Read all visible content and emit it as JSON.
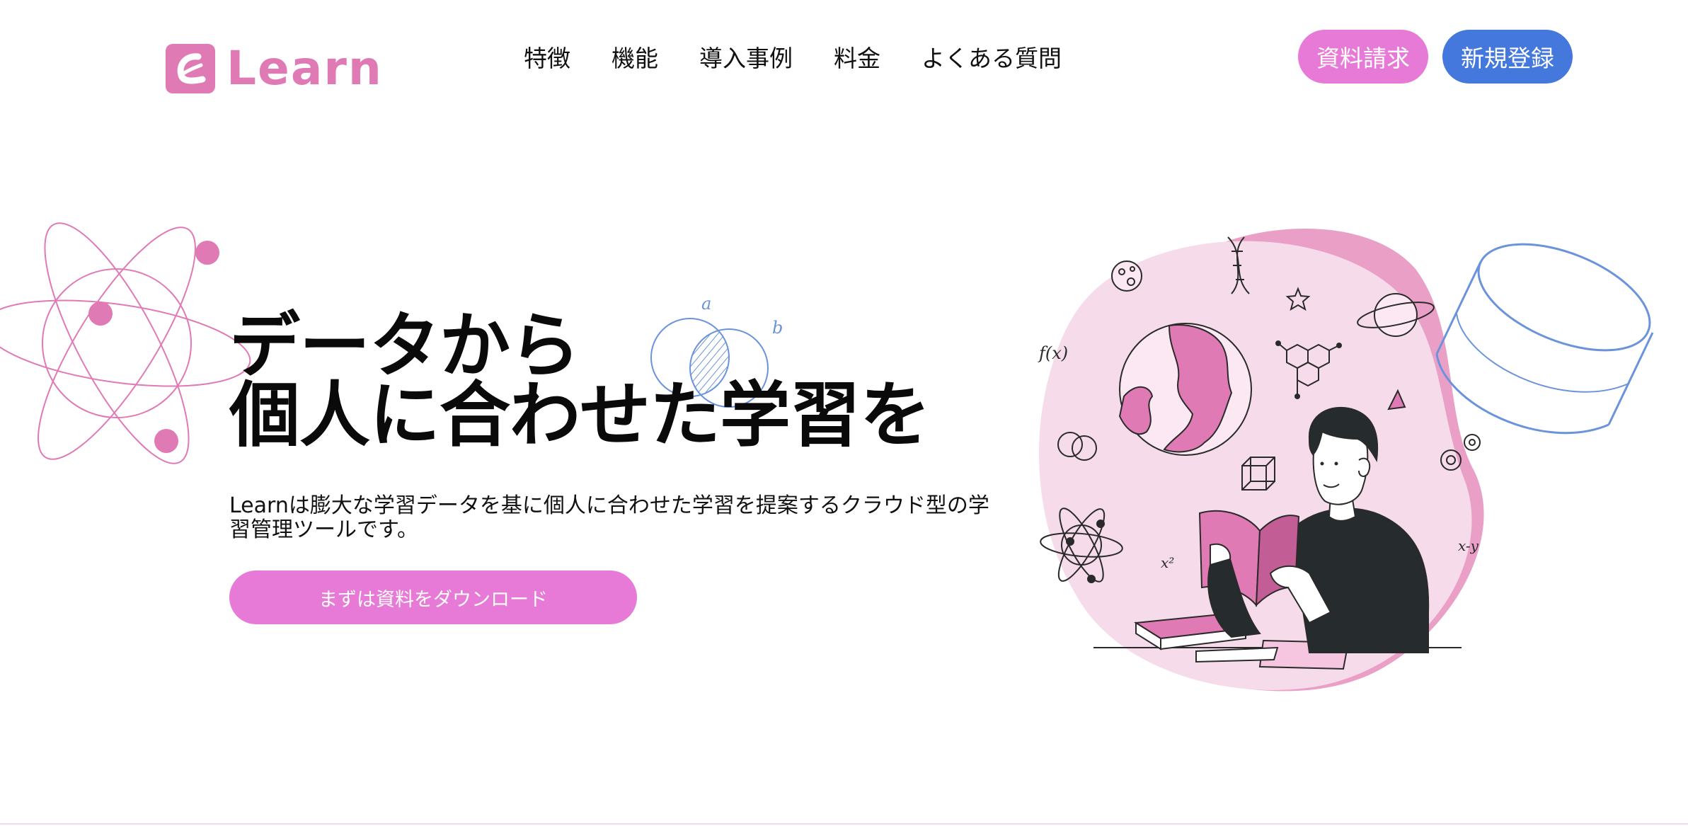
{
  "brand": {
    "name": "Learn",
    "color": "#e07ab5"
  },
  "nav": {
    "items": [
      "特徴",
      "機能",
      "導入事例",
      "料金",
      "よくある質問"
    ]
  },
  "header_buttons": {
    "document_request": "資料請求",
    "register": "新規登録",
    "document_color": "#e67ad6",
    "register_color": "#4478dc"
  },
  "hero": {
    "title_line1": "データから",
    "title_line2": "個人に合わせた学習を",
    "description": "Learnは膨大な学習データを基に個人に合わせた学習を提案するクラウド型の学習管理ツールです。",
    "cta_label": "まずは資料をダウンロード"
  },
  "illustration": {
    "venn_label_a": "a",
    "venn_label_b": "b",
    "function_label": "f(x)",
    "squared_label": "x²",
    "equation_label": "x-y",
    "icons": [
      "atom-icon",
      "venn-diagram-icon",
      "globe-icon",
      "cylinder-icon",
      "student-reading-icon",
      "dna-icon",
      "planet-icon",
      "molecule-icon",
      "cube-icon",
      "gear-icon",
      "star-icon",
      "moon-icon"
    ]
  }
}
